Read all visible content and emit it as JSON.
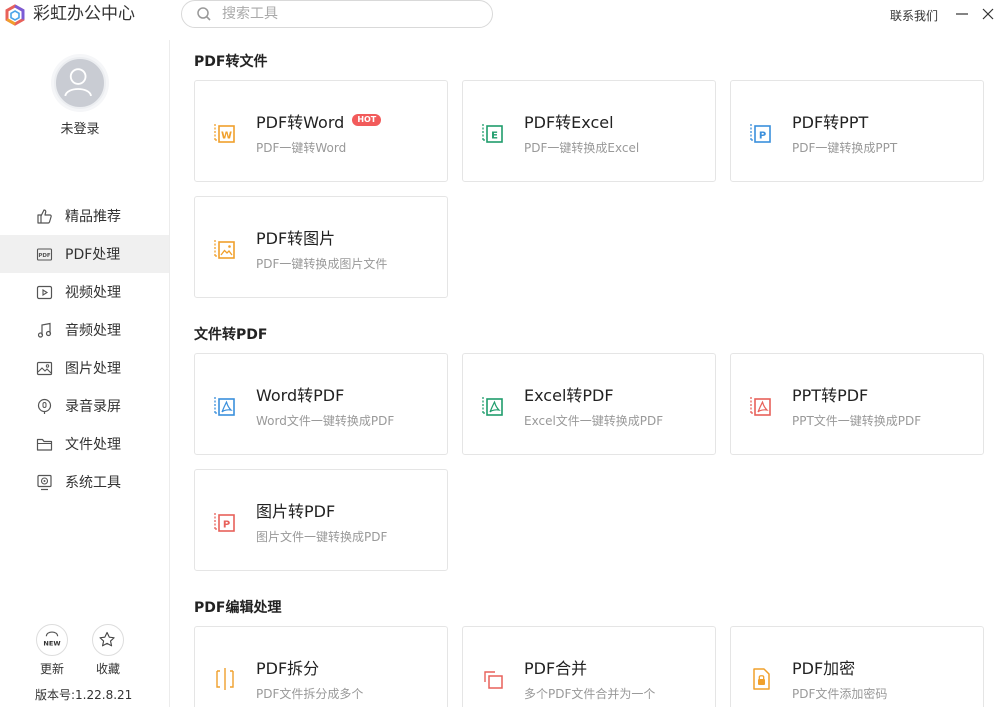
{
  "app": {
    "title": "彩虹办公中心"
  },
  "search": {
    "placeholder": "搜索工具"
  },
  "header": {
    "contact": "联系我们"
  },
  "user": {
    "status": "未登录"
  },
  "sidebar": {
    "items": [
      {
        "label": "精品推荐",
        "icon": "thumbs-up-icon"
      },
      {
        "label": "PDF处理",
        "icon": "pdf-icon",
        "active": true
      },
      {
        "label": "视频处理",
        "icon": "video-icon"
      },
      {
        "label": "音频处理",
        "icon": "music-note-icon"
      },
      {
        "label": "图片处理",
        "icon": "image-icon"
      },
      {
        "label": "录音录屏",
        "icon": "record-icon"
      },
      {
        "label": "文件处理",
        "icon": "folder-icon"
      },
      {
        "label": "系统工具",
        "icon": "system-tool-icon"
      }
    ],
    "update_badge": "NEW",
    "update_label": "更新",
    "favorite_label": "收藏",
    "version": "版本号:1.22.8.21"
  },
  "sections": [
    {
      "title": "PDF转文件",
      "cards": [
        {
          "title": "PDF转Word",
          "desc": "PDF一键转Word",
          "badge": "HOT",
          "icon": "word-doc-icon",
          "color": "#f0a02c",
          "letter": "W"
        },
        {
          "title": "PDF转Excel",
          "desc": "PDF一键转换成Excel",
          "icon": "excel-doc-icon",
          "color": "#1f9d6c",
          "letter": "E"
        },
        {
          "title": "PDF转PPT",
          "desc": "PDF一键转换成PPT",
          "icon": "ppt-doc-icon",
          "color": "#3a8fdc",
          "letter": "P"
        },
        {
          "title": "PDF转图片",
          "desc": "PDF一键转换成图片文件",
          "icon": "image-doc-icon",
          "color": "#f0a02c"
        }
      ]
    },
    {
      "title": "文件转PDF",
      "cards": [
        {
          "title": "Word转PDF",
          "desc": "Word文件一键转换成PDF",
          "icon": "word-to-pdf-icon",
          "color": "#3a8fdc"
        },
        {
          "title": "Excel转PDF",
          "desc": "Excel文件一键转换成PDF",
          "icon": "excel-to-pdf-icon",
          "color": "#1f9d6c"
        },
        {
          "title": "PPT转PDF",
          "desc": "PPT文件一键转换成PDF",
          "icon": "ppt-to-pdf-icon",
          "color": "#e8615a"
        },
        {
          "title": "图片转PDF",
          "desc": "图片文件一键转换成PDF",
          "icon": "image-to-pdf-icon",
          "color": "#e8615a",
          "letter": "P"
        }
      ]
    },
    {
      "title": "PDF编辑处理",
      "cards": [
        {
          "title": "PDF拆分",
          "desc": "PDF文件拆分成多个",
          "icon": "split-icon",
          "color": "#f0a02c"
        },
        {
          "title": "PDF合并",
          "desc": "多个PDF文件合并为一个",
          "icon": "merge-icon",
          "color": "#e8615a"
        },
        {
          "title": "PDF加密",
          "desc": "PDF文件添加密码",
          "icon": "lock-icon",
          "color": "#f0a02c"
        }
      ]
    }
  ]
}
